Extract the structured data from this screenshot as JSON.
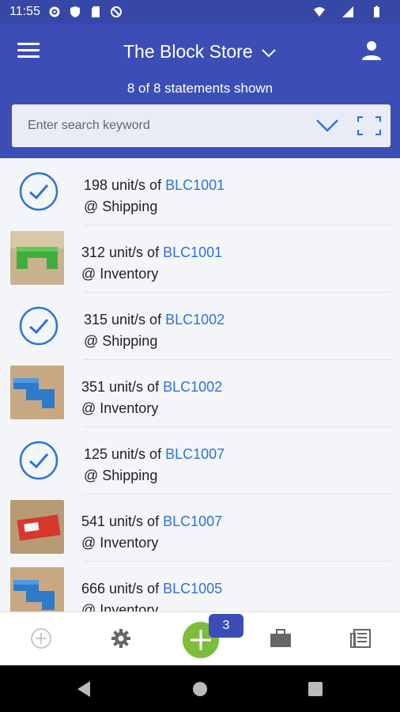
{
  "status_bar": {
    "time": "11:55"
  },
  "app_bar": {
    "title": "The Block Store",
    "subtitle": "8 of 8 statements shown"
  },
  "search": {
    "placeholder": "Enter search keyword"
  },
  "statements": [
    {
      "line1_prefix": "198 unit/s of ",
      "code": "BLC1001",
      "location": "@ Shipping",
      "kind": "check"
    },
    {
      "line1_prefix": "312 unit/s of ",
      "code": "BLC1001",
      "location": "@ Inventory",
      "kind": "photo-green-block"
    },
    {
      "line1_prefix": "315 unit/s of ",
      "code": "BLC1002",
      "location": "@ Shipping",
      "kind": "check"
    },
    {
      "line1_prefix": "351 unit/s of ",
      "code": "BLC1002",
      "location": "@ Inventory",
      "kind": "photo-blue-block"
    },
    {
      "line1_prefix": "125 unit/s of ",
      "code": "BLC1007",
      "location": "@ Shipping",
      "kind": "check"
    },
    {
      "line1_prefix": "541 unit/s of ",
      "code": "BLC1007",
      "location": "@ Inventory",
      "kind": "photo-red-box"
    },
    {
      "line1_prefix": "666 unit/s of ",
      "code": "BLC1005",
      "location": "@ Inventory",
      "kind": "photo-blue-block"
    }
  ],
  "bottom_nav": {
    "items": [
      "add-circle-icon",
      "gear-icon",
      "add-fab-icon",
      "briefcase-icon",
      "news-icon"
    ],
    "badge_count": "3"
  },
  "colors": {
    "app_bar": "#3c4db6",
    "link": "#2f73d8",
    "fab": "#7dbd3c",
    "check": "#2f73d8"
  }
}
